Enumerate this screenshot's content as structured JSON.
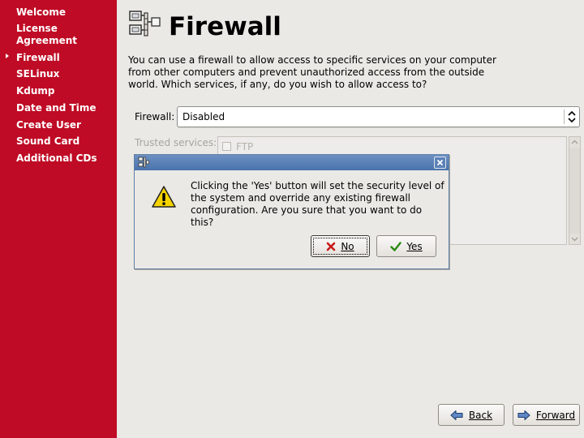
{
  "sidebar": {
    "items": [
      {
        "label": "Welcome"
      },
      {
        "label": "License\nAgreement"
      },
      {
        "label": "Firewall",
        "current": true
      },
      {
        "label": "SELinux"
      },
      {
        "label": "Kdump"
      },
      {
        "label": "Date and Time"
      },
      {
        "label": "Create User"
      },
      {
        "label": "Sound Card"
      },
      {
        "label": "Additional CDs"
      }
    ]
  },
  "header": {
    "title": "Firewall",
    "icon": "firewall-computers-icon"
  },
  "main": {
    "description": "You can use a firewall to allow access to specific services on your computer\nfrom other computers and prevent unauthorized access from the outside\nworld.  Which services, if any, do you wish to allow access to?",
    "firewall_label": "Firewall:",
    "firewall_value": "Disabled",
    "trusted_label": "Trusted services:",
    "services": [
      {
        "label": "FTP",
        "checked": false
      }
    ]
  },
  "dialog": {
    "message": "Clicking the 'Yes' button will set the security level of\nthe system and override any existing firewall\nconfiguration.  Are you sure that you want to do this?",
    "no_label": "No",
    "yes_label": "Yes",
    "icon": "warning-icon"
  },
  "nav": {
    "back_label": "Back",
    "forward_label": "Forward"
  },
  "colors": {
    "sidebar": "#bf0b25",
    "background": "#ebe9e5",
    "titlebar": "#5a80b6"
  }
}
